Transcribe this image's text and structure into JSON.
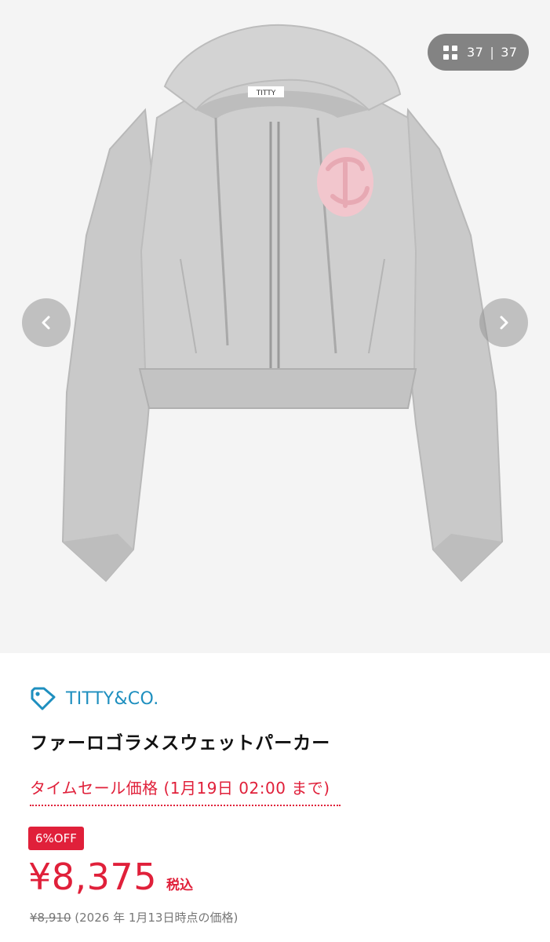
{
  "gallery": {
    "current": "37",
    "separator": "|",
    "total": "37",
    "grid_icon": "grid-icon",
    "prev_icon": "chevron-left-icon",
    "next_icon": "chevron-right-icon",
    "product_label": "TITTY"
  },
  "product": {
    "brand": "TITTY&CO.",
    "brand_icon": "tag-icon",
    "title": "ファーロゴラメスウェットパーカー",
    "sale_text": "タイムセール価格 (1月19日 02:00 まで)",
    "discount_badge": "6%OFF",
    "price": "¥8,375",
    "tax_label": "税込",
    "original_price": "¥8,910",
    "original_note": "(2026 年 1月13日時点の価格)"
  },
  "colors": {
    "accent_red": "#e0203a",
    "brand_blue": "#1e8fbf"
  }
}
